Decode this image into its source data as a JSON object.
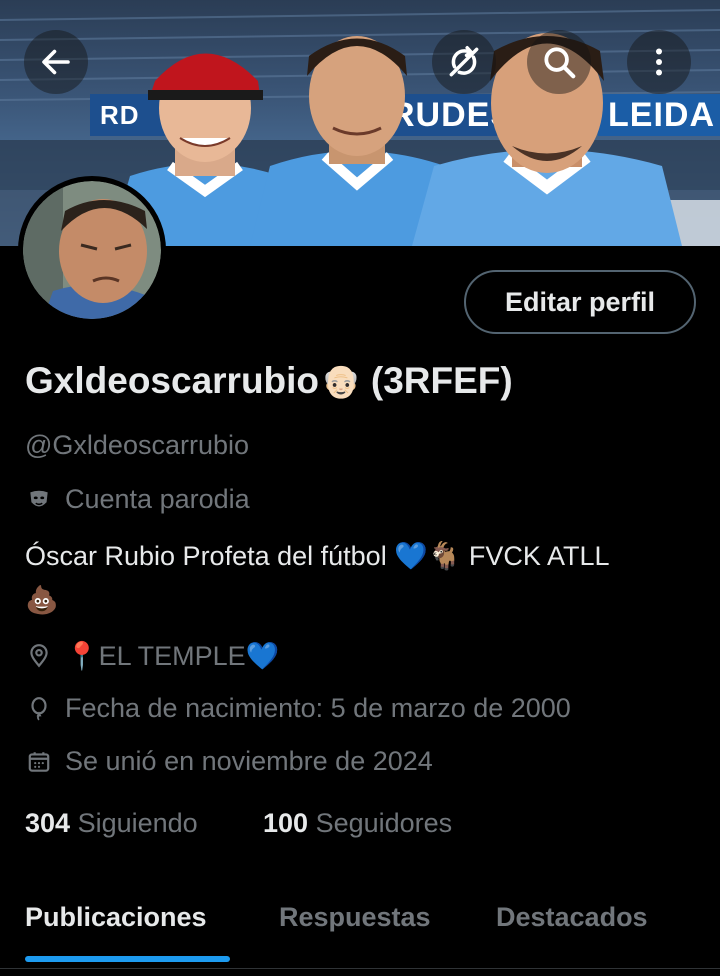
{
  "header": {
    "back_icon": "arrow-left-icon",
    "sync_icon": "sync-off-icon",
    "search_icon": "search-icon",
    "more_icon": "more-vertical-icon",
    "banner_texts": [
      "RUDES",
      "LEIDA",
      "RD"
    ]
  },
  "profile": {
    "edit_button": "Editar perfil",
    "display_name": "Gxldeoscarrubio",
    "name_emoji": "👴🏻",
    "name_suffix": "(3RFEF)",
    "handle": "@Gxldeoscarrubio",
    "parody_label": "Cuenta parodia",
    "bio_text": "Óscar Rubio Profeta del fútbol 💙🐐 FVCK ATLL",
    "bio_emoji": "💩",
    "location": "📍EL TEMPLE💙",
    "birth": "Fecha de nacimiento: 5 de marzo de 2000",
    "joined": "Se unió en noviembre de 2024"
  },
  "stats": {
    "following_count": "304",
    "following_label": "Siguiendo",
    "followers_count": "100",
    "followers_label": "Seguidores"
  },
  "tabs": {
    "posts": "Publicaciones",
    "replies": "Respuestas",
    "highlights": "Destacados"
  },
  "colors": {
    "accent": "#1d9bf0",
    "background": "#000000",
    "text_primary": "#e7e9ea",
    "text_secondary": "#71767b"
  }
}
